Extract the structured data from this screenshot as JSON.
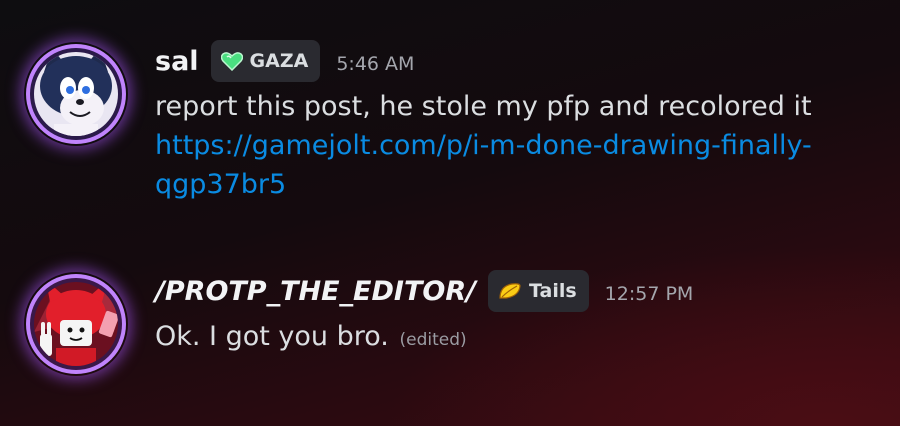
{
  "messages": [
    {
      "username": "sal",
      "tag": {
        "label": "GAZA",
        "icon": "green-heart-icon"
      },
      "timestamp": "5:46 AM",
      "text": "report this post, he stole my pfp and recolored it",
      "link": "https://gamejolt.com/p/i-m-done-drawing-finally-qgp37br5"
    },
    {
      "username": "/PROTP_THE_EDITOR/",
      "tag": {
        "label": "Tails",
        "icon": "yellow-leaf-icon"
      },
      "timestamp": "12:57 PM",
      "text": "Ok. I got you bro.",
      "edited": "(edited)"
    }
  ],
  "colors": {
    "link": "#0a8be2",
    "avatar_glow": "#a855f7",
    "tag_bg": "#2a2a30"
  }
}
